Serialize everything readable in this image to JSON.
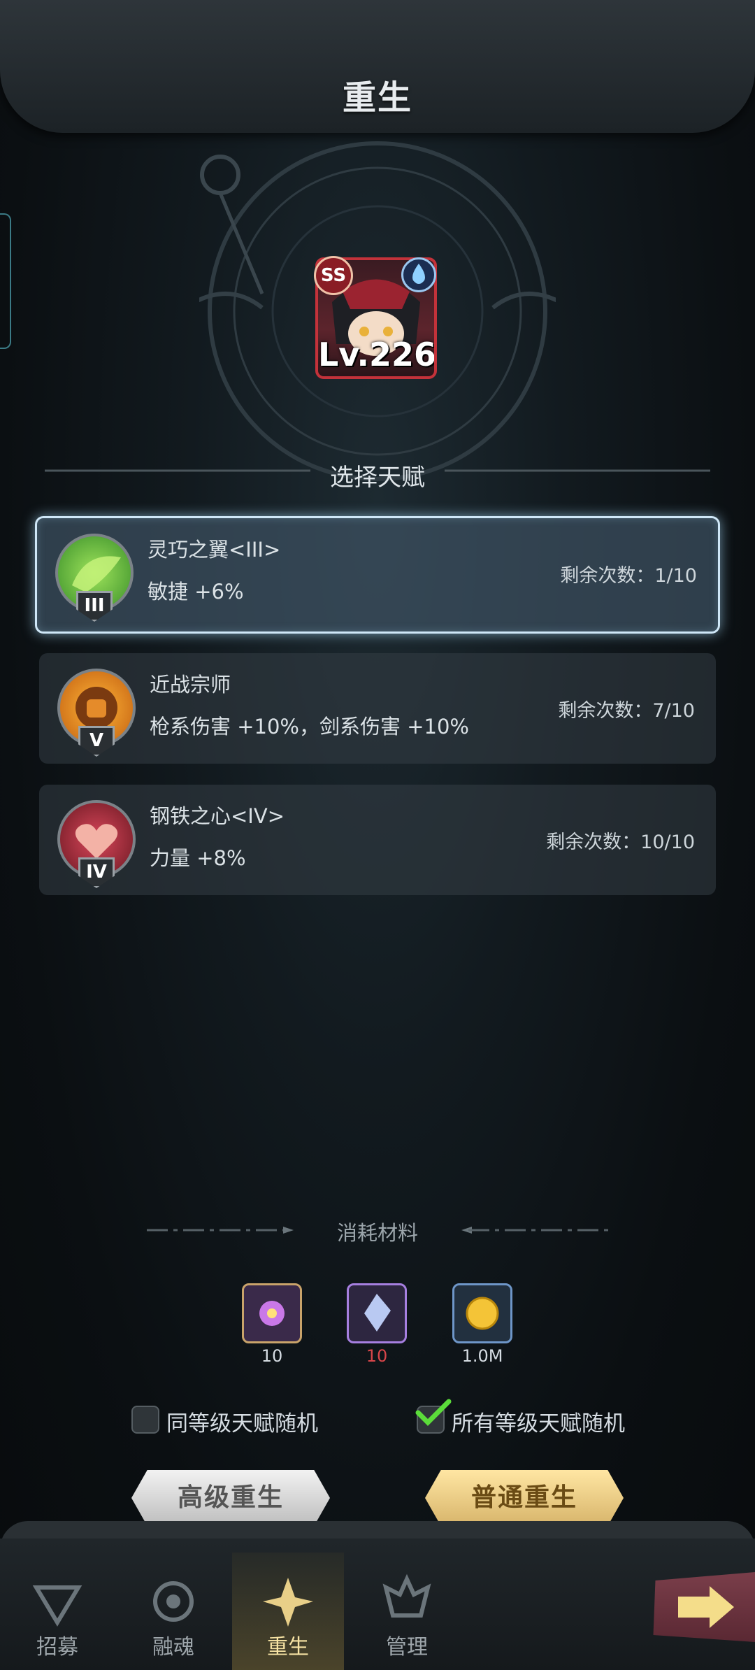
{
  "header": {
    "title": "重生"
  },
  "hero": {
    "level": "Lv.226",
    "rank": "SS",
    "element_icon": "water-drop-icon"
  },
  "select_label": "选择天赋",
  "talents": [
    {
      "name": "灵巧之翼<III>",
      "effect": "敏捷 +6%",
      "remaining": "剩余次数：1/10",
      "grade": "III",
      "icon": "green-wing-icon",
      "selected": true
    },
    {
      "name": "近战宗师",
      "effect": "枪系伤害 +10%，剑系伤害 +10%",
      "remaining": "剩余次数：7/10",
      "grade": "V",
      "icon": "fist-sun-icon",
      "selected": false
    },
    {
      "name": "钢铁之心<IV>",
      "effect": "力量 +8%",
      "remaining": "剩余次数：10/10",
      "grade": "IV",
      "icon": "heart-icon",
      "selected": false
    }
  ],
  "materials": {
    "label": "消耗材料",
    "items": [
      {
        "icon": "purple-flower-icon",
        "value": "10",
        "color": "#d6dde3"
      },
      {
        "icon": "crystal-icon",
        "value": "10",
        "color": "#d9464a"
      },
      {
        "icon": "gold-coin-icon",
        "value": "1.0M",
        "color": "#d6dde3"
      }
    ]
  },
  "options": [
    {
      "label": "同等级天赋随机",
      "checked": false
    },
    {
      "label": "所有等级天赋随机",
      "checked": true
    }
  ],
  "buttons": {
    "advanced": "高级重生",
    "normal": "普通重生"
  },
  "nav": [
    {
      "label": "招募",
      "icon": "recruit-icon",
      "active": false
    },
    {
      "label": "融魂",
      "icon": "soul-fusion-icon",
      "active": false
    },
    {
      "label": "重生",
      "icon": "rebirth-icon",
      "active": true
    },
    {
      "label": "管理",
      "icon": "manage-icon",
      "active": false
    }
  ],
  "colors": {
    "accent_gold": "#f7e3a4",
    "selected_border": "#cfe7f7",
    "alert_red": "#d9464a"
  }
}
